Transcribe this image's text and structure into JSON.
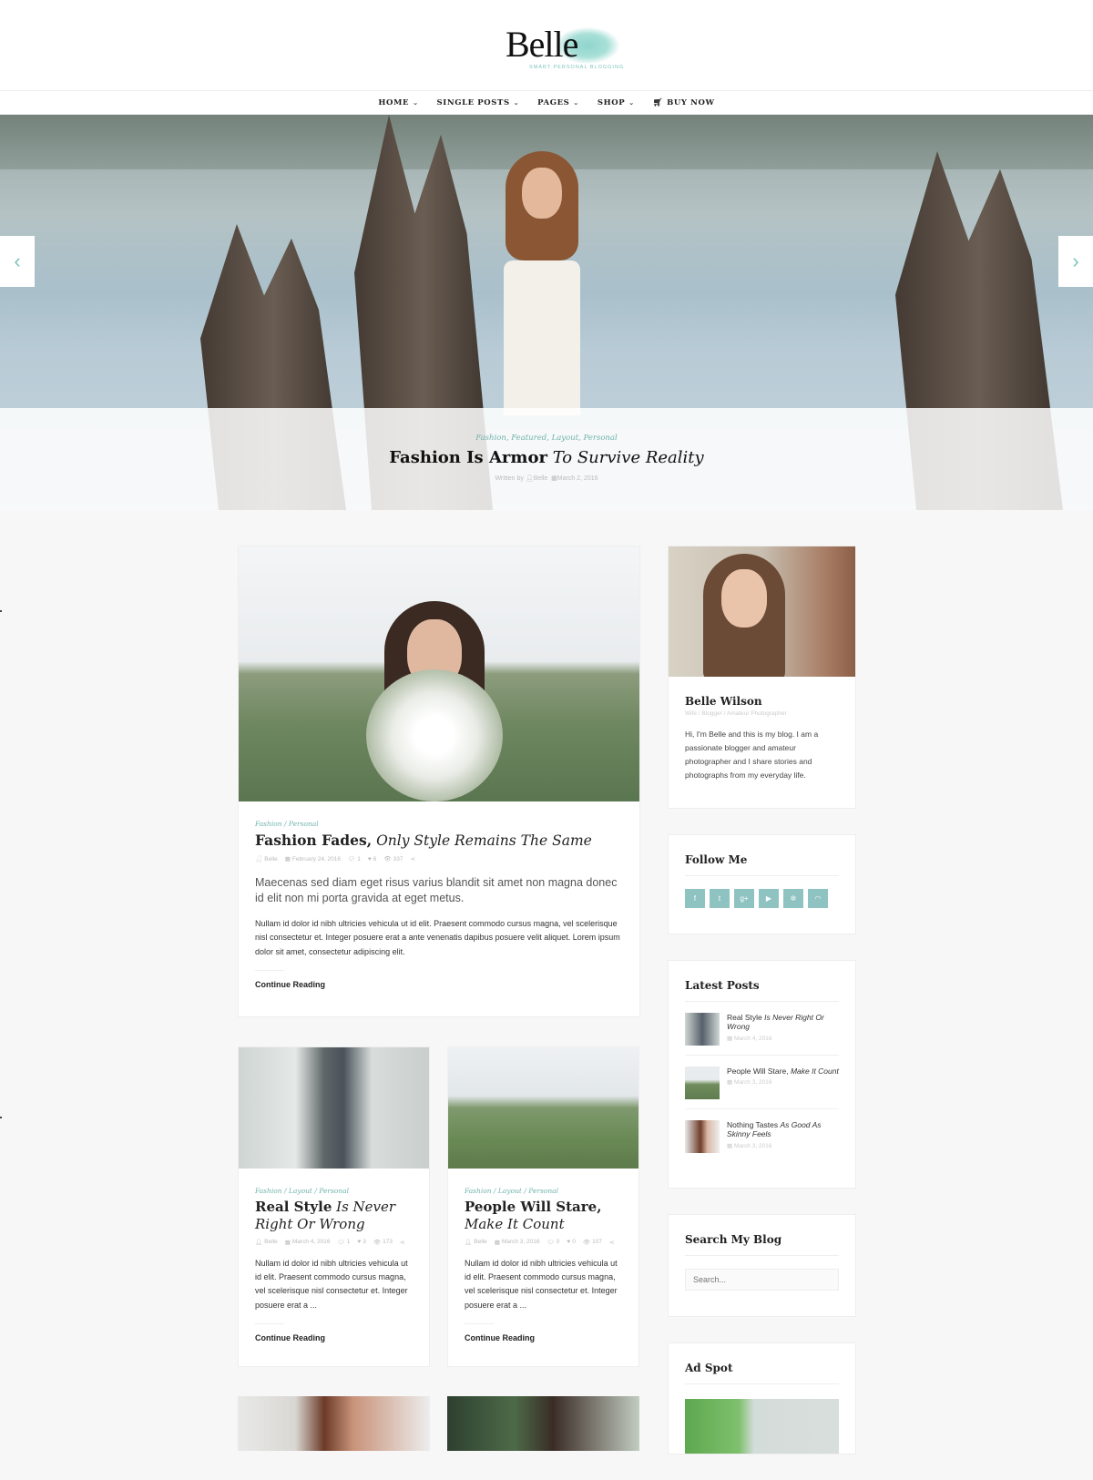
{
  "site": {
    "logo": "Belle",
    "tagline": "SMART PERSONAL BLOGGING"
  },
  "nav": {
    "items": [
      {
        "label": "HOME",
        "dropdown": true
      },
      {
        "label": "SINGLE POSTS",
        "dropdown": true
      },
      {
        "label": "PAGES",
        "dropdown": true
      },
      {
        "label": "SHOP",
        "dropdown": true
      },
      {
        "label": "BUY NOW",
        "icon": "cart-icon",
        "dropdown": false
      }
    ]
  },
  "hero": {
    "categories": "Fashion, Featured, Layout, Personal",
    "title_bold": "Fashion Is Armor",
    "title_italic": "To Survive Reality",
    "written_by": "Written by",
    "author": "Belle",
    "date": "March 2, 2016",
    "prev_icon": "chevron-left-icon",
    "next_icon": "chevron-right-icon"
  },
  "featured_post": {
    "categories": "Fashion / Personal",
    "title_bold": "Fashion Fades,",
    "title_italic": "Only Style Remains The Same",
    "author": "Belle",
    "date": "February 24, 2016",
    "comments": "1",
    "likes": "6",
    "views": "337",
    "lead": "Maecenas sed diam eget risus varius blandit sit amet non magna donec id elit non mi porta gravida at eget metus.",
    "excerpt": "Nullam id dolor id nibh ultricies vehicula ut id elit. Praesent commodo cursus magna, vel scelerisque nisl consectetur et. Integer posuere erat a ante venenatis dapibus posuere velit aliquet. Lorem ipsum dolor sit amet, consectetur adipiscing elit.",
    "continue": "Continue Reading"
  },
  "posts": [
    {
      "categories": "Fashion / Layout / Personal",
      "title_bold": "Real Style",
      "title_italic": "Is Never Right Or Wrong",
      "author": "Belle",
      "date": "March 4, 2016",
      "comments": "1",
      "likes": "3",
      "views": "173",
      "excerpt": "Nullam id dolor id nibh ultricies vehicula ut id elit. Praesent commodo cursus magna, vel scelerisque nisl consectetur et. Integer posuere erat a ...",
      "continue": "Continue Reading"
    },
    {
      "categories": "Fashion / Layout / Personal",
      "title_bold": "People Will Stare,",
      "title_italic": "Make It Count",
      "author": "Belle",
      "date": "March 3, 2016",
      "comments": "0",
      "likes": "0",
      "views": "107",
      "excerpt": "Nullam id dolor id nibh ultricies vehicula ut id elit. Praesent commodo cursus magna, vel scelerisque nisl consectetur et. Integer posuere erat a ...",
      "continue": "Continue Reading"
    }
  ],
  "sidebar": {
    "about": {
      "name": "Belle Wilson",
      "subtitle": "Wife / Blogger / Amateur Photographer",
      "text": "Hi, I'm Belle and this is my blog. I am a passionate blogger and amateur photographer and I share stories and photographs from my everyday life."
    },
    "follow": {
      "title": "Follow Me",
      "icons": [
        {
          "name": "facebook-icon",
          "glyph": "f"
        },
        {
          "name": "twitter-icon",
          "glyph": "t"
        },
        {
          "name": "google-plus-icon",
          "glyph": "g+"
        },
        {
          "name": "youtube-icon",
          "glyph": "▶"
        },
        {
          "name": "flickr-icon",
          "glyph": "✲"
        },
        {
          "name": "rss-icon",
          "glyph": "◠"
        }
      ]
    },
    "latest": {
      "title": "Latest Posts",
      "items": [
        {
          "title": "Real Style",
          "title_italic": "Is Never Right Or Wrong",
          "date": "March 4, 2016"
        },
        {
          "title": "People Will Stare,",
          "title_italic": "Make It Count",
          "date": "March 3, 2016"
        },
        {
          "title": "Nothing Tastes",
          "title_italic": "As Good As Skinny Feels",
          "date": "March 3, 2016"
        }
      ]
    },
    "search": {
      "title": "Search My Blog",
      "placeholder": "Search..."
    },
    "ad": {
      "title": "Ad Spot"
    }
  }
}
